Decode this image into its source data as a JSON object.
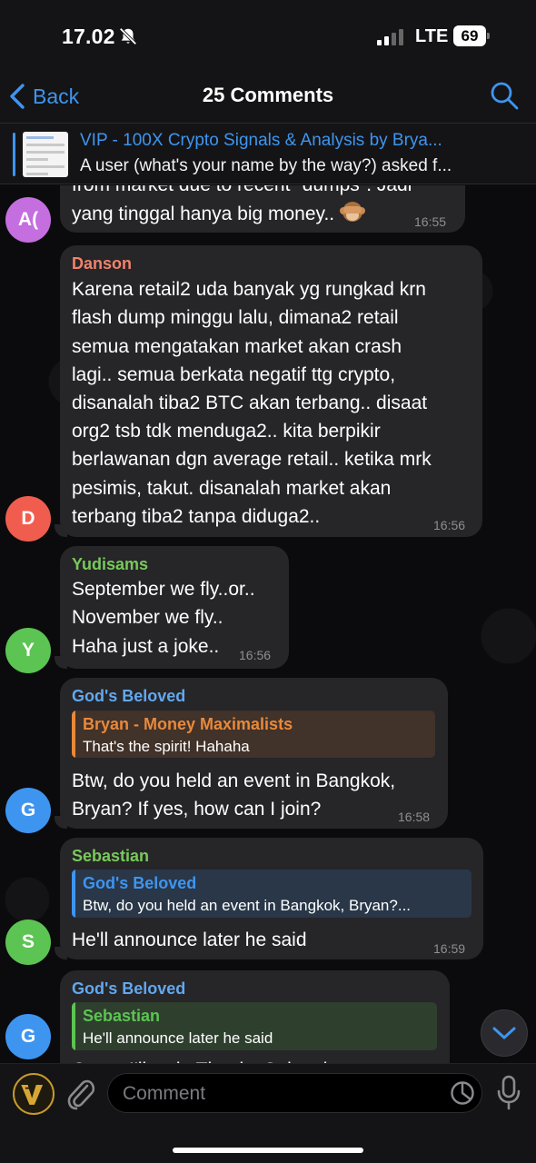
{
  "status_bar": {
    "time": "17.02",
    "network": "LTE",
    "battery": "69"
  },
  "nav": {
    "back_label": "Back",
    "title": "25 Comments"
  },
  "pinned": {
    "title": "VIP - 100X Crypto Signals & Analysis by Brya...",
    "subtitle": "A user (what's your name by the way?) asked f..."
  },
  "messages": [
    {
      "avatar_initials": "A(",
      "avatar_color": "#c46ee0",
      "text_lines": [
        "from market due to recent \"dumps\". Jadi",
        "yang tinggal hanya big money.."
      ],
      "emoji": "see-no-evil-monkey",
      "time": "16:55"
    },
    {
      "avatar_initials": "D",
      "avatar_color": "#f05d4e",
      "sender": "Danson",
      "sender_color": "#f0836b",
      "text_lines": [
        "Karena retail2 uda banyak yg rungkad krn",
        "flash dump minggu lalu, dimana2 retail",
        "semua mengatakan market akan crash",
        "lagi.. semua berkata negatif ttg crypto,",
        "disanalah tiba2 BTC akan terbang.. disaat",
        "org2 tsb tdk menduga2.. kita berpikir",
        "berlawanan dgn average retail.. ketika mrk",
        "pesimis, takut. disanalah market akan",
        "terbang tiba2 tanpa diduga2.."
      ],
      "time": "16:56"
    },
    {
      "avatar_initials": "Y",
      "avatar_color": "#5cc452",
      "sender": "Yudisams",
      "sender_color": "#78c95a",
      "text_lines": [
        "September we fly..or..",
        "November we fly..",
        "Haha just a joke.."
      ],
      "time": "16:56"
    },
    {
      "avatar_initials": "G",
      "avatar_color": "#3e95f0",
      "sender": "God's Beloved",
      "sender_color": "#62a8ee",
      "reply": {
        "name": "Bryan - Money Maximalists",
        "text": "That's the spirit! Hahaha",
        "color": "#e8893a"
      },
      "text_lines": [
        "Btw, do you held an event in Bangkok,",
        "Bryan? If yes, how can I join?"
      ],
      "time": "16:58"
    },
    {
      "avatar_initials": "S",
      "avatar_color": "#5cc452",
      "sender": "Sebastian",
      "sender_color": "#78c95a",
      "reply": {
        "name": "God's Beloved",
        "text": "Btw, do you held an event in Bangkok, Bryan?...",
        "color": "#3e95f0"
      },
      "text_lines": [
        "He'll announce later he said"
      ],
      "time": "16:59"
    },
    {
      "avatar_initials": "G",
      "avatar_color": "#3e95f0",
      "sender": "God's Beloved",
      "sender_color": "#62a8ee",
      "reply": {
        "name": "Sebastian",
        "text": "He'll announce later he said",
        "color": "#5cc452"
      },
      "text_lines": [
        "Oooo, I'll wait. Thanks Sebastian"
      ]
    }
  ],
  "composer": {
    "placeholder": "Comment"
  },
  "colors": {
    "accent": "#3e95f0",
    "bubble": "#262528",
    "bar": "#141416"
  },
  "icons": [
    "bell-slash-icon",
    "signal-icon",
    "chevron-left-icon",
    "search-icon",
    "chevron-down-icon",
    "paperclip-icon",
    "sticker-icon",
    "microphone-icon",
    "bot-logo-icon",
    "see-no-evil-monkey-icon"
  ]
}
